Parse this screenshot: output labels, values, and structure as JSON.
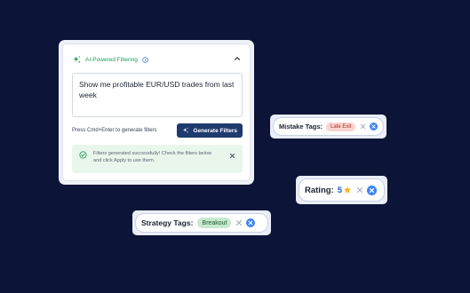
{
  "ai_panel": {
    "header_label": "AI-Powered Filtering",
    "query_text": "Show me profitable EUR/USD trades from last week",
    "hint": "Press Cmd+Enter to generate filters",
    "generate_button": "Generate Filters",
    "success_message": "Filters generated successfully! Check the filters below and click Apply to use them.",
    "icons": [
      "sparkle-icon",
      "info-icon",
      "chevron-up-icon",
      "check-circle-icon",
      "close-icon"
    ]
  },
  "filters": {
    "mistake": {
      "label": "Mistake Tags:",
      "tag": "Late Exit"
    },
    "rating": {
      "label": "Rating:",
      "value": "5"
    },
    "strategy": {
      "label": "Strategy Tags:",
      "tag": "Breakout"
    }
  },
  "colors": {
    "background": "#0c1437",
    "accent_green": "#1f9d55",
    "button_navy": "#1e3a6e",
    "rating_blue": "#2a58c8",
    "star_yellow": "#f5b82e",
    "mistake_tag_bg": "#fbd3cf",
    "strategy_tag_bg": "#c9e9cf"
  }
}
